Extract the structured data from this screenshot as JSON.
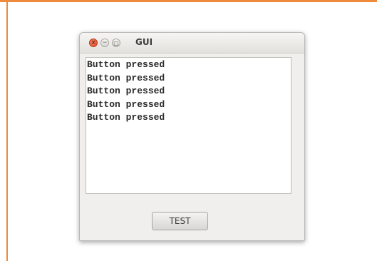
{
  "window": {
    "title": "GUI",
    "controls": {
      "close_glyph": "×",
      "minimize_glyph": "−",
      "maximize_glyph": "□"
    }
  },
  "output": {
    "lines": [
      "Button pressed",
      "Button pressed",
      "Button pressed",
      "Button pressed",
      "Button pressed"
    ]
  },
  "button": {
    "label": "TEST"
  },
  "colors": {
    "frame_accent": "#ee8a3a",
    "close_button": "#e0482a"
  }
}
